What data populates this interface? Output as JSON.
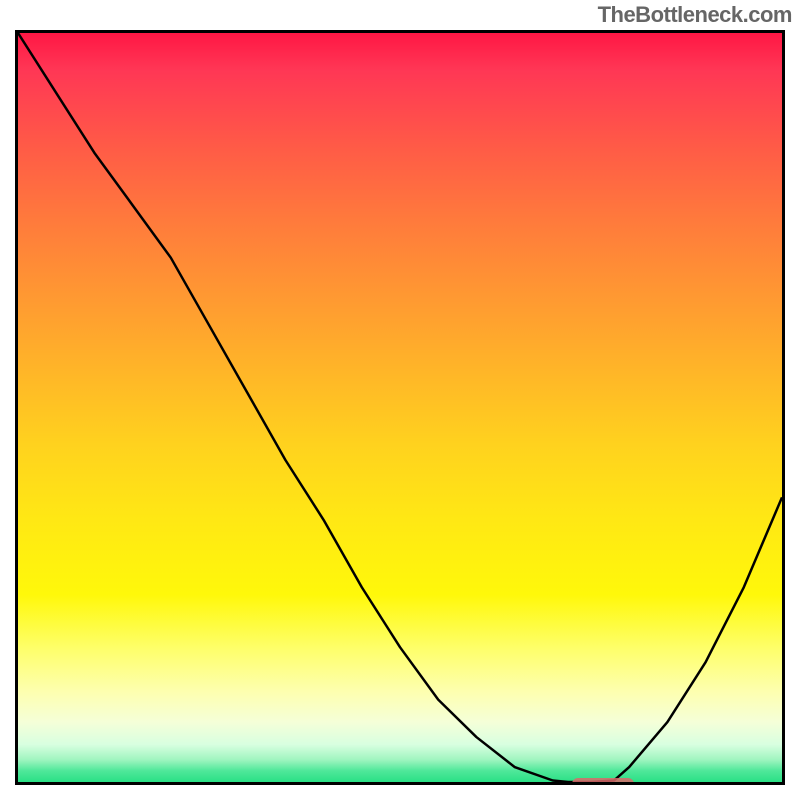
{
  "watermark": "TheBottleneck.com",
  "chart_data": {
    "type": "line",
    "title": "",
    "xlabel": "",
    "ylabel": "",
    "x": [
      0.0,
      0.05,
      0.1,
      0.15,
      0.2,
      0.25,
      0.3,
      0.35,
      0.4,
      0.45,
      0.5,
      0.55,
      0.6,
      0.65,
      0.7,
      0.72,
      0.75,
      0.78,
      0.8,
      0.85,
      0.9,
      0.95,
      1.0
    ],
    "values": [
      1.0,
      0.92,
      0.84,
      0.77,
      0.7,
      0.61,
      0.52,
      0.43,
      0.35,
      0.26,
      0.18,
      0.11,
      0.06,
      0.02,
      0.002,
      0.0,
      0.0,
      0.002,
      0.02,
      0.08,
      0.16,
      0.26,
      0.38
    ],
    "xlim": [
      0,
      1
    ],
    "ylim": [
      0,
      1
    ],
    "gradient_stops": [
      {
        "pos": 0.0,
        "color": "#ff1744"
      },
      {
        "pos": 0.5,
        "color": "#ffd21e"
      },
      {
        "pos": 0.85,
        "color": "#feff90"
      },
      {
        "pos": 0.97,
        "color": "#a0f5c0"
      },
      {
        "pos": 1.0,
        "color": "#2ae085"
      }
    ],
    "marker": {
      "x_start": 0.72,
      "x_end": 0.8,
      "y": 0.0,
      "color": "#d96a6a"
    }
  },
  "plot": {
    "area_w": 770,
    "area_h": 755
  }
}
